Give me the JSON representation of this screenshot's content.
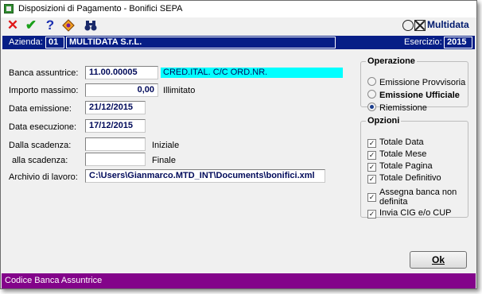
{
  "window": {
    "title": "Disposizioni di Pagamento - Bonifici SEPA"
  },
  "toolbar": {
    "icons": [
      "close-icon",
      "confirm-icon",
      "help-icon",
      "tools-icon",
      "binoculars-icon"
    ],
    "logo_text": "Multidata"
  },
  "header": {
    "azienda_label": "Azienda:",
    "azienda_code": "01",
    "azienda_name": "MULTIDATA S.r.L.",
    "esercizio_label": "Esercizio:",
    "esercizio_value": "2015"
  },
  "form": {
    "banca_label": "Banca assuntrice:",
    "banca_value": "11.00.00005",
    "banca_desc": "CRED.ITAL. C/C ORD.NR.",
    "importo_label": "Importo massimo:",
    "importo_value": "0,00",
    "importo_note": "Illimitato",
    "data_emissione_label": "Data emissione:",
    "data_emissione_value": "21/12/2015",
    "data_esecuzione_label": "Data esecuzione:",
    "data_esecuzione_value": "17/12/2015",
    "dalla_label": "Dalla scadenza:",
    "dalla_value": "",
    "dalla_note": "Iniziale",
    "alla_label": "alla scadenza:",
    "alla_value": "",
    "alla_note": "Finale",
    "archivio_label": "Archivio di lavoro:",
    "archivio_value": "C:\\Users\\Gianmarco.MTD_INT\\Documents\\bonifici.xml"
  },
  "operazione": {
    "legend": "Operazione",
    "options": [
      {
        "label": "Emissione Provvisoria",
        "selected": false
      },
      {
        "label": "Emissione Ufficiale",
        "selected": false
      },
      {
        "label": "Riemissione",
        "selected": true
      }
    ]
  },
  "opzioni": {
    "legend": "Opzioni",
    "items": [
      {
        "label": "Totale Data",
        "checked": true
      },
      {
        "label": "Totale Mese",
        "checked": true
      },
      {
        "label": "Totale Pagina",
        "checked": true
      },
      {
        "label": "Totale Definitivo",
        "checked": true
      },
      {
        "label_line1": "Assegna banca non",
        "label_line2": "definita",
        "checked": true
      },
      {
        "label": "Invia CIG e/o CUP",
        "checked": true
      }
    ]
  },
  "buttons": {
    "ok_label": "Ok"
  },
  "status": {
    "text": "Codice Banca Assuntrice"
  },
  "colors": {
    "band": "#061e86",
    "status_bar": "#83048a",
    "highlight": "#00ffff"
  }
}
